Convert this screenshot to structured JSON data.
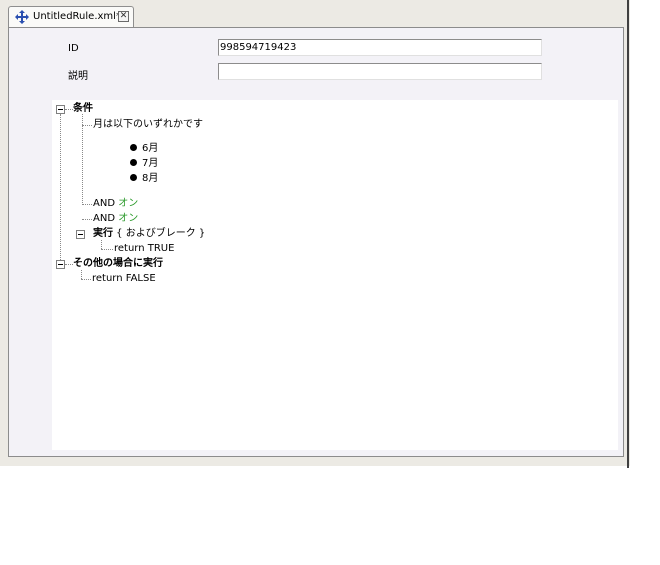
{
  "tab": {
    "title": "UntitledRule.xml*",
    "icon": "rule-icon",
    "close_icon": "close-icon"
  },
  "form": {
    "id_label": "ID",
    "id_value": "998594719423",
    "desc_label": "説明",
    "desc_value": ""
  },
  "tree": {
    "condition": {
      "label": "条件",
      "month_rule": "月は以下のいずれかです",
      "months": [
        "6月",
        "7月",
        "8月"
      ],
      "and1_prefix": "AND",
      "and1_value": "オン",
      "and2_prefix": "AND",
      "and2_value": "オン",
      "execute": {
        "label": "実行",
        "suffix": " { およびブレーク }",
        "return": "return TRUE"
      }
    },
    "otherwise": {
      "label": "その他の場合に実行",
      "return": "return FALSE"
    }
  },
  "colors": {
    "on_value": "#2b9a2b"
  }
}
